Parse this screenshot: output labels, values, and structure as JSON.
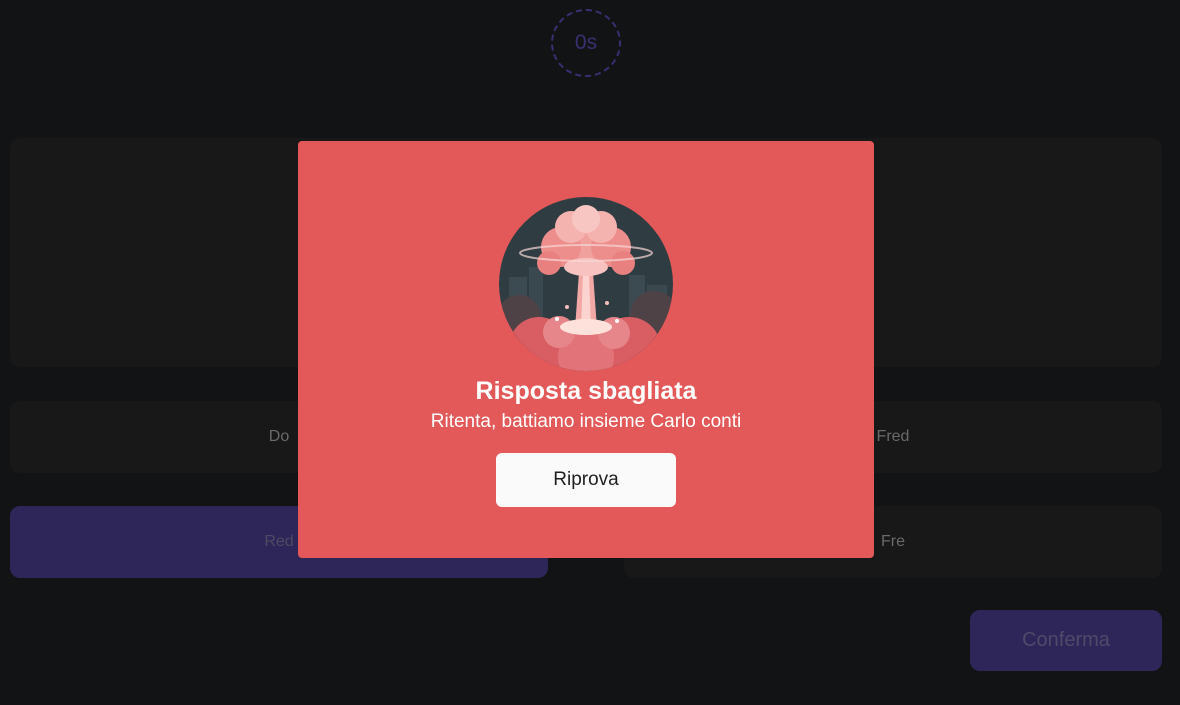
{
  "timer": {
    "text": "0s"
  },
  "answers": [
    {
      "label": "Do",
      "selected": false
    },
    {
      "label": "Fred",
      "selected": false
    },
    {
      "label": "Red",
      "selected": true
    },
    {
      "label": "Fre",
      "selected": false
    }
  ],
  "confirm_label": "Conferma",
  "modal": {
    "title": "Risposta sbagliata",
    "subtitle": "Ritenta, battiamo insieme Carlo conti",
    "retry_label": "Riprova",
    "illustration_icon": "explosion-mushroom-cloud-icon"
  },
  "colors": {
    "background": "#121314",
    "modal": "#e35858",
    "accent": "#2e2658"
  }
}
